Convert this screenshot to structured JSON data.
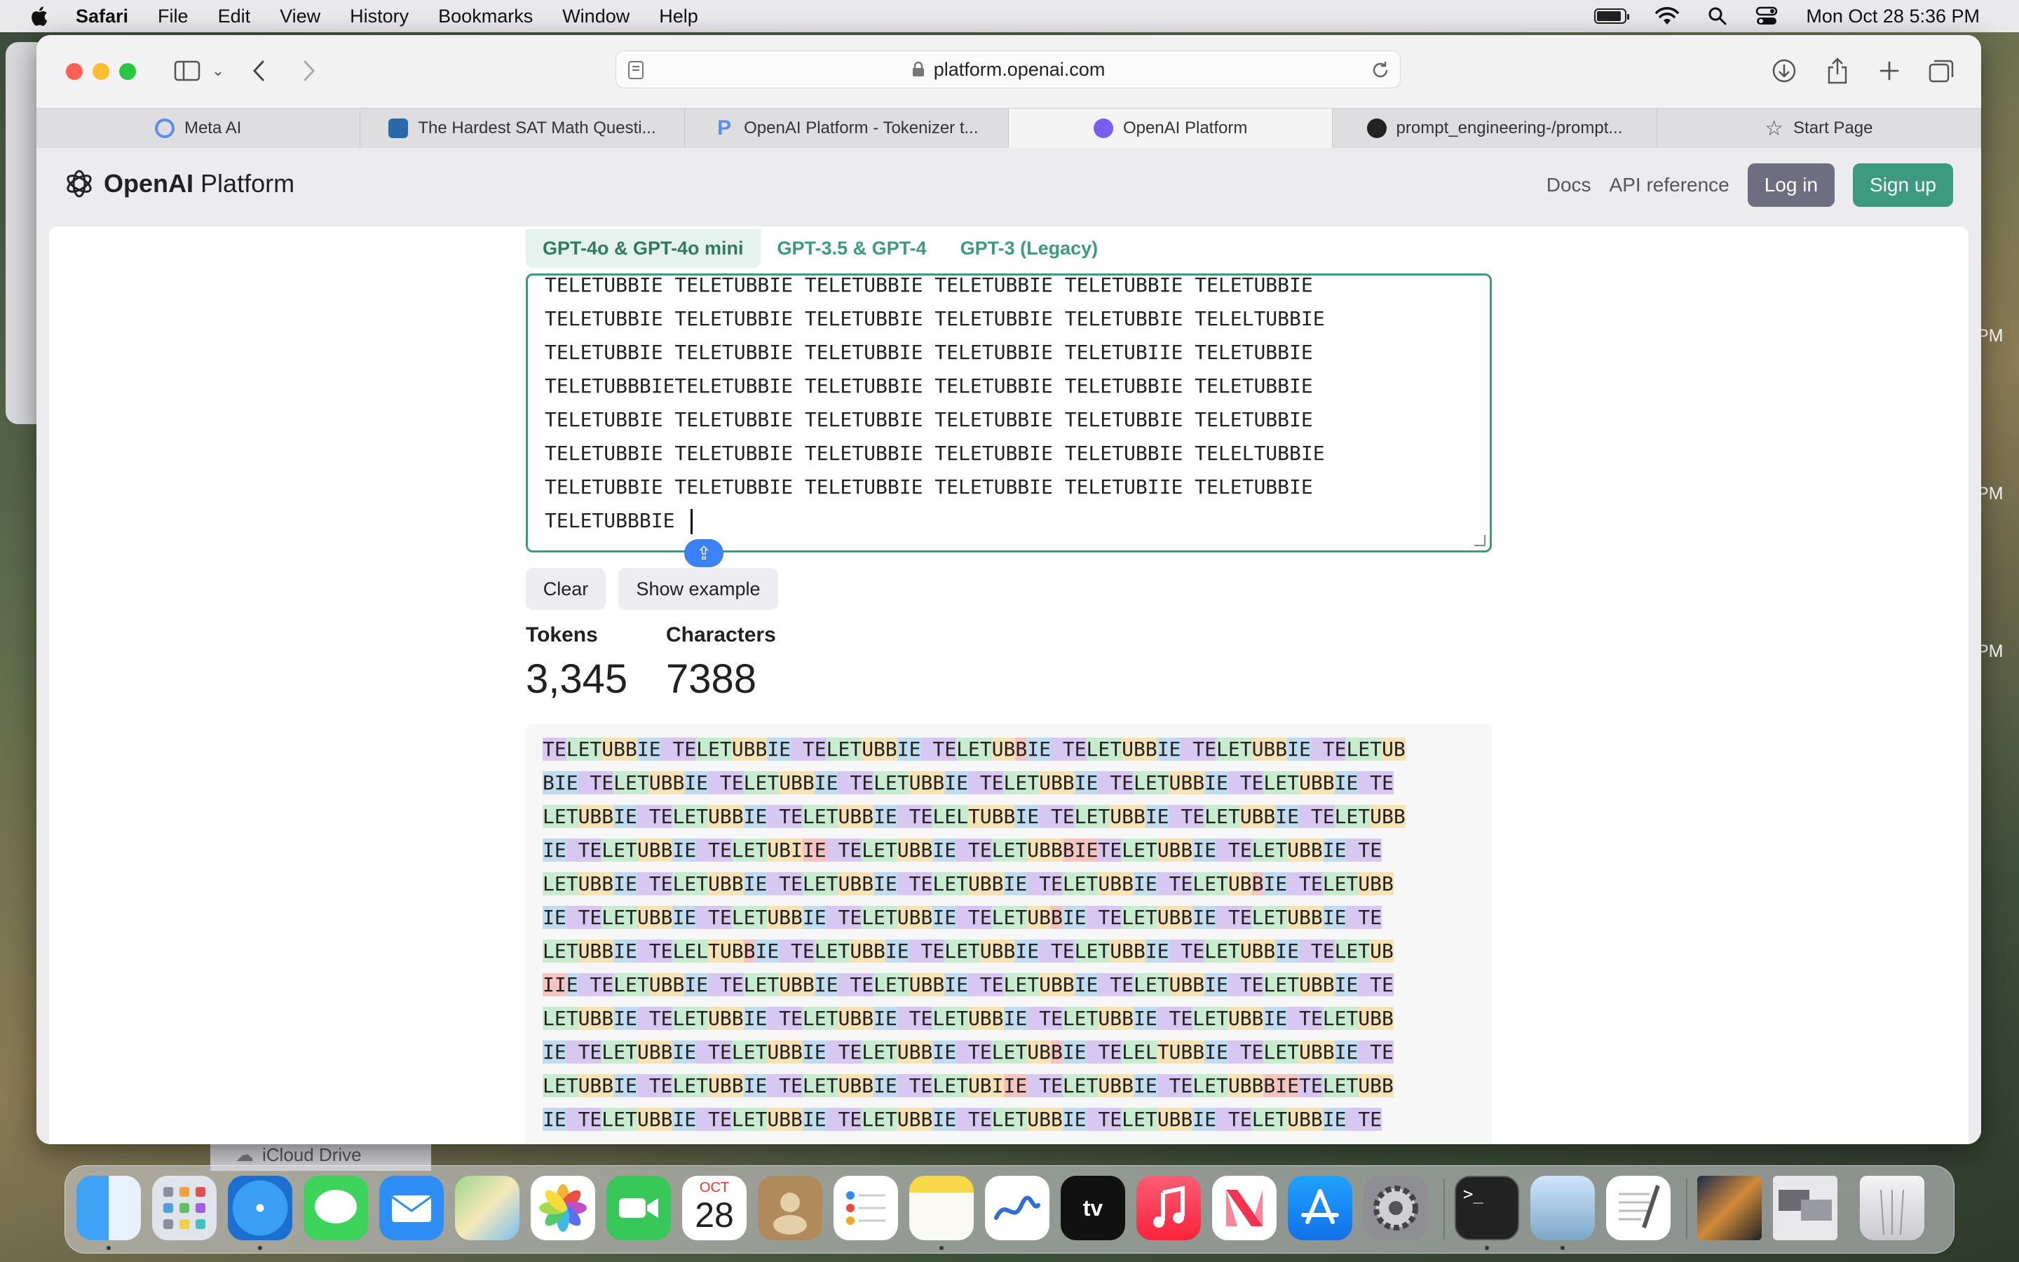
{
  "menubar": {
    "app": "Safari",
    "items": [
      "File",
      "Edit",
      "View",
      "History",
      "Bookmarks",
      "Window",
      "Help"
    ],
    "datetime": "Mon Oct 28  5:36 PM"
  },
  "background": {
    "clock_fragments": [
      "PM",
      "PM",
      "PM"
    ],
    "icloud_label": "iCloud Drive"
  },
  "browser": {
    "url": "platform.openai.com",
    "tabs": [
      {
        "label": "Meta AI",
        "icon": "meta-ai-ring-icon"
      },
      {
        "label": "The Hardest SAT Math Questi...",
        "icon": "pen-fish-icon"
      },
      {
        "label": "OpenAI Platform - Tokenizer t...",
        "icon": "p-logo-icon"
      },
      {
        "label": "OpenAI Platform",
        "icon": "openai-favicon",
        "active": true
      },
      {
        "label": "prompt_engineering-/prompt...",
        "icon": "github-icon"
      },
      {
        "label": "Start Page",
        "icon": "star-icon"
      }
    ]
  },
  "site": {
    "logo_text_bold": "OpenAI",
    "logo_text": "Platform",
    "nav": {
      "docs": "Docs",
      "api": "API reference",
      "login": "Log in",
      "signup": "Sign up"
    }
  },
  "tokenizer": {
    "model_tabs": [
      "GPT-4o & GPT-4o mini",
      "GPT-3.5 & GPT-4",
      "GPT-3 (Legacy)"
    ],
    "input_lines": [
      "TELETUBBIE TELETUBBIE TELETUBBIE TELETUBBIE TELETUBBIE TELETUBBIE",
      "TELETUBBIE TELETUBBIE TELETUBBIE TELETUBBIE TELETUBBIE TELELTUBBIE",
      "TELETUBBIE TELETUBBIE TELETUBBIE TELETUBBIE TELETUBIIE TELETUBBIE",
      "TELETUBBBIETELETUBBIE TELETUBBIE TELETUBBIE TELETUBBIE TELETUBBIE",
      "TELETUBBIE TELETUBBIE TELETUBBIE TELETUBBIE TELETUBBIE TELETUBBIE",
      "TELETUBBIE TELETUBBIE TELETUBBIE TELETUBBIE TELETUBBIE TELELTUBBIE",
      "TELETUBBIE TELETUBBIE TELETUBBIE TELETUBBIE TELETUBIIE TELETUBBIE",
      "TELETUBBBIE "
    ],
    "buttons": {
      "clear": "Clear",
      "example": "Show example"
    },
    "stats": {
      "tokens_label": "Tokens",
      "tokens": "3,345",
      "chars_label": "Characters",
      "chars": "7388"
    },
    "token_lines": [
      [
        [
          "TE",
          1
        ],
        [
          "LET",
          2
        ],
        [
          "UBB",
          3
        ],
        [
          "IE",
          5
        ],
        [
          " TE",
          1
        ],
        [
          "LET",
          2
        ],
        [
          "UBB",
          3
        ],
        [
          "IE",
          5
        ],
        [
          " TE",
          1
        ],
        [
          "LET",
          2
        ],
        [
          "UBB",
          3
        ],
        [
          "IE",
          5
        ],
        [
          " TE",
          1
        ],
        [
          "LET",
          2
        ],
        [
          "UB",
          3
        ],
        [
          "B",
          4
        ],
        [
          "IE",
          5
        ],
        [
          " TE",
          1
        ],
        [
          "LET",
          2
        ],
        [
          "UBB",
          3
        ],
        [
          "IE",
          5
        ],
        [
          " TE",
          1
        ],
        [
          "LET",
          2
        ],
        [
          "UBB",
          3
        ],
        [
          "IE",
          5
        ],
        [
          " TE",
          1
        ],
        [
          "LET",
          2
        ],
        [
          "UB",
          3
        ]
      ],
      [
        [
          "BIE",
          5
        ],
        [
          " TE",
          1
        ],
        [
          "LET",
          2
        ],
        [
          "UBB",
          3
        ],
        [
          "IE",
          5
        ],
        [
          " TE",
          1
        ],
        [
          "LET",
          2
        ],
        [
          "UBB",
          3
        ],
        [
          "IE",
          5
        ],
        [
          " TE",
          1
        ],
        [
          "LET",
          2
        ],
        [
          "UBB",
          3
        ],
        [
          "IE",
          5
        ],
        [
          " TE",
          1
        ],
        [
          "LET",
          2
        ],
        [
          "UBB",
          3
        ],
        [
          "IE",
          5
        ],
        [
          " TE",
          1
        ],
        [
          "LET",
          2
        ],
        [
          "UBB",
          3
        ],
        [
          "IE",
          5
        ],
        [
          " TE",
          1
        ],
        [
          "LET",
          2
        ],
        [
          "UBB",
          3
        ],
        [
          "IE",
          5
        ],
        [
          " TE",
          1
        ]
      ],
      [
        [
          "LET",
          2
        ],
        [
          "UBB",
          3
        ],
        [
          "IE",
          5
        ],
        [
          " TE",
          1
        ],
        [
          "LET",
          2
        ],
        [
          "UBB",
          3
        ],
        [
          "IE",
          5
        ],
        [
          " TE",
          1
        ],
        [
          "LET",
          2
        ],
        [
          "UBB",
          3
        ],
        [
          "IE",
          5
        ],
        [
          " TE",
          1
        ],
        [
          "LEL",
          2
        ],
        [
          "TUBB",
          3
        ],
        [
          "IE",
          5
        ],
        [
          " TE",
          1
        ],
        [
          "LET",
          2
        ],
        [
          "UBB",
          3
        ],
        [
          "IE",
          5
        ],
        [
          " TE",
          1
        ],
        [
          "LET",
          2
        ],
        [
          "UBB",
          3
        ],
        [
          "IE",
          5
        ],
        [
          " TE",
          1
        ],
        [
          "LET",
          2
        ],
        [
          "UBB",
          3
        ]
      ],
      [
        [
          "IE",
          5
        ],
        [
          " TE",
          1
        ],
        [
          "LET",
          2
        ],
        [
          "UBB",
          3
        ],
        [
          "IE",
          5
        ],
        [
          " TE",
          1
        ],
        [
          "LET",
          2
        ],
        [
          "UBI",
          3
        ],
        [
          "IE",
          4
        ],
        [
          " TE",
          1
        ],
        [
          "LET",
          2
        ],
        [
          "UBB",
          3
        ],
        [
          "IE",
          5
        ],
        [
          " TE",
          1
        ],
        [
          "LET",
          2
        ],
        [
          "UBB",
          3
        ],
        [
          "BIE",
          4
        ],
        [
          "TE",
          1
        ],
        [
          "LET",
          2
        ],
        [
          "UBB",
          3
        ],
        [
          "IE",
          5
        ],
        [
          " TE",
          1
        ],
        [
          "LET",
          2
        ],
        [
          "UBB",
          3
        ],
        [
          "IE",
          5
        ],
        [
          " TE",
          1
        ]
      ],
      [
        [
          "LET",
          2
        ],
        [
          "UBB",
          3
        ],
        [
          "IE",
          5
        ],
        [
          " TE",
          1
        ],
        [
          "LET",
          2
        ],
        [
          "UBB",
          3
        ],
        [
          "IE",
          5
        ],
        [
          " TE",
          1
        ],
        [
          "LET",
          2
        ],
        [
          "UBB",
          3
        ],
        [
          "IE",
          5
        ],
        [
          " TE",
          1
        ],
        [
          "LET",
          2
        ],
        [
          "UBB",
          3
        ],
        [
          "IE",
          5
        ],
        [
          " TE",
          1
        ],
        [
          "LET",
          2
        ],
        [
          "UBB",
          3
        ],
        [
          "IE",
          5
        ],
        [
          " TE",
          1
        ],
        [
          "LET",
          2
        ],
        [
          "UB",
          3
        ],
        [
          "B",
          4
        ],
        [
          "IE",
          5
        ],
        [
          " TE",
          1
        ],
        [
          "LET",
          2
        ],
        [
          "UBB",
          3
        ]
      ],
      [
        [
          "IE",
          5
        ],
        [
          " TE",
          1
        ],
        [
          "LET",
          2
        ],
        [
          "UBB",
          3
        ],
        [
          "IE",
          5
        ],
        [
          " TE",
          1
        ],
        [
          "LET",
          2
        ],
        [
          "UBB",
          3
        ],
        [
          "IE",
          5
        ],
        [
          " TE",
          1
        ],
        [
          "LET",
          2
        ],
        [
          "UBB",
          3
        ],
        [
          "IE",
          5
        ],
        [
          " TE",
          1
        ],
        [
          "LET",
          2
        ],
        [
          "UB",
          3
        ],
        [
          "B",
          4
        ],
        [
          "IE",
          5
        ],
        [
          " TE",
          1
        ],
        [
          "LET",
          2
        ],
        [
          "UBB",
          3
        ],
        [
          "IE",
          5
        ],
        [
          " TE",
          1
        ],
        [
          "LET",
          2
        ],
        [
          "UBB",
          3
        ],
        [
          "IE",
          5
        ],
        [
          " TE",
          1
        ]
      ],
      [
        [
          "LET",
          2
        ],
        [
          "UBB",
          3
        ],
        [
          "IE",
          5
        ],
        [
          " TE",
          1
        ],
        [
          "LEL",
          2
        ],
        [
          "TUB",
          3
        ],
        [
          "B",
          4
        ],
        [
          "IE",
          5
        ],
        [
          " TE",
          1
        ],
        [
          "LET",
          2
        ],
        [
          "UBB",
          3
        ],
        [
          "IE",
          5
        ],
        [
          " TE",
          1
        ],
        [
          "LET",
          2
        ],
        [
          "UBB",
          3
        ],
        [
          "IE",
          5
        ],
        [
          " TE",
          1
        ],
        [
          "LET",
          2
        ],
        [
          "UBB",
          3
        ],
        [
          "IE",
          5
        ],
        [
          " TE",
          1
        ],
        [
          "LET",
          2
        ],
        [
          "UBB",
          3
        ],
        [
          "IE",
          5
        ],
        [
          " TE",
          1
        ],
        [
          "LET",
          2
        ],
        [
          "UB",
          3
        ]
      ],
      [
        [
          "II",
          4
        ],
        [
          "E",
          5
        ],
        [
          " TE",
          1
        ],
        [
          "LET",
          2
        ],
        [
          "UBB",
          3
        ],
        [
          "IE",
          5
        ],
        [
          " TE",
          1
        ],
        [
          "LET",
          2
        ],
        [
          "UBB",
          3
        ],
        [
          "IE",
          5
        ],
        [
          " TE",
          1
        ],
        [
          "LET",
          2
        ],
        [
          "UBB",
          3
        ],
        [
          "IE",
          5
        ],
        [
          " TE",
          1
        ],
        [
          "LET",
          2
        ],
        [
          "UBB",
          3
        ],
        [
          "IE",
          5
        ],
        [
          " TE",
          1
        ],
        [
          "LET",
          2
        ],
        [
          "UBB",
          3
        ],
        [
          "IE",
          5
        ],
        [
          " TE",
          1
        ],
        [
          "LET",
          2
        ],
        [
          "UBB",
          3
        ],
        [
          "IE",
          5
        ],
        [
          " TE",
          1
        ]
      ],
      [
        [
          "LET",
          2
        ],
        [
          "UBB",
          3
        ],
        [
          "IE",
          5
        ],
        [
          " TE",
          1
        ],
        [
          "LET",
          2
        ],
        [
          "UBB",
          3
        ],
        [
          "IE",
          5
        ],
        [
          " TE",
          1
        ],
        [
          "LET",
          2
        ],
        [
          "UBB",
          3
        ],
        [
          "IE",
          5
        ],
        [
          " TE",
          1
        ],
        [
          "LET",
          2
        ],
        [
          "UBB",
          3
        ],
        [
          "IE",
          5
        ],
        [
          " TE",
          1
        ],
        [
          "LET",
          2
        ],
        [
          "UBB",
          3
        ],
        [
          "IE",
          5
        ],
        [
          " TE",
          1
        ],
        [
          "LET",
          2
        ],
        [
          "UBB",
          3
        ],
        [
          "IE",
          5
        ],
        [
          " TE",
          1
        ],
        [
          "LET",
          2
        ],
        [
          "UBB",
          3
        ]
      ],
      [
        [
          "IE",
          5
        ],
        [
          " TE",
          1
        ],
        [
          "LET",
          2
        ],
        [
          "UBB",
          3
        ],
        [
          "IE",
          5
        ],
        [
          " TE",
          1
        ],
        [
          "LET",
          2
        ],
        [
          "UBB",
          3
        ],
        [
          "IE",
          5
        ],
        [
          " TE",
          1
        ],
        [
          "LET",
          2
        ],
        [
          "UBB",
          3
        ],
        [
          "IE",
          5
        ],
        [
          " TE",
          1
        ],
        [
          "LET",
          2
        ],
        [
          "UB",
          3
        ],
        [
          "B",
          4
        ],
        [
          "IE",
          5
        ],
        [
          " TE",
          1
        ],
        [
          "LEL",
          2
        ],
        [
          "TUBB",
          3
        ],
        [
          "IE",
          5
        ],
        [
          " TE",
          1
        ],
        [
          "LET",
          2
        ],
        [
          "UBB",
          3
        ],
        [
          "IE",
          5
        ],
        [
          " TE",
          1
        ]
      ],
      [
        [
          "LET",
          2
        ],
        [
          "UBB",
          3
        ],
        [
          "IE",
          5
        ],
        [
          " TE",
          1
        ],
        [
          "LET",
          2
        ],
        [
          "UBB",
          3
        ],
        [
          "IE",
          5
        ],
        [
          " TE",
          1
        ],
        [
          "LET",
          2
        ],
        [
          "UBB",
          3
        ],
        [
          "IE",
          5
        ],
        [
          " TE",
          1
        ],
        [
          "LET",
          2
        ],
        [
          "UBI",
          3
        ],
        [
          "IE",
          4
        ],
        [
          " TE",
          1
        ],
        [
          "LET",
          2
        ],
        [
          "UBB",
          3
        ],
        [
          "IE",
          5
        ],
        [
          " TE",
          1
        ],
        [
          "LET",
          2
        ],
        [
          "UBB",
          3
        ],
        [
          "BIE",
          4
        ],
        [
          "TE",
          1
        ],
        [
          "LET",
          2
        ],
        [
          "UBB",
          3
        ]
      ],
      [
        [
          "IE",
          5
        ],
        [
          " TE",
          1
        ],
        [
          "LET",
          2
        ],
        [
          "UBB",
          3
        ],
        [
          "IE",
          5
        ],
        [
          " TE",
          1
        ],
        [
          "LET",
          2
        ],
        [
          "UBB",
          3
        ],
        [
          "IE",
          5
        ],
        [
          " TE",
          1
        ],
        [
          "LET",
          2
        ],
        [
          "UBB",
          3
        ],
        [
          "IE",
          5
        ],
        [
          " TE",
          1
        ],
        [
          "LET",
          2
        ],
        [
          "UBB",
          3
        ],
        [
          "IE",
          5
        ],
        [
          " TE",
          1
        ],
        [
          "LET",
          2
        ],
        [
          "UBB",
          3
        ],
        [
          "IE",
          5
        ],
        [
          " TE",
          1
        ],
        [
          "LET",
          2
        ],
        [
          "UBB",
          3
        ],
        [
          "IE",
          5
        ],
        [
          " TE",
          1
        ]
      ]
    ]
  },
  "dock": {
    "calendar_month": "OCT",
    "calendar_day": "28",
    "apps": [
      "finder",
      "launchpad",
      "safari",
      "messages",
      "mail",
      "maps",
      "photos",
      "facetime",
      "calendar",
      "contacts",
      "reminders",
      "notes",
      "freeform",
      "tv",
      "music",
      "news",
      "app-store",
      "system-settings",
      "terminal",
      "preview",
      "textedit",
      "photo-thumb",
      "screenshot-thumb",
      "trash"
    ]
  }
}
